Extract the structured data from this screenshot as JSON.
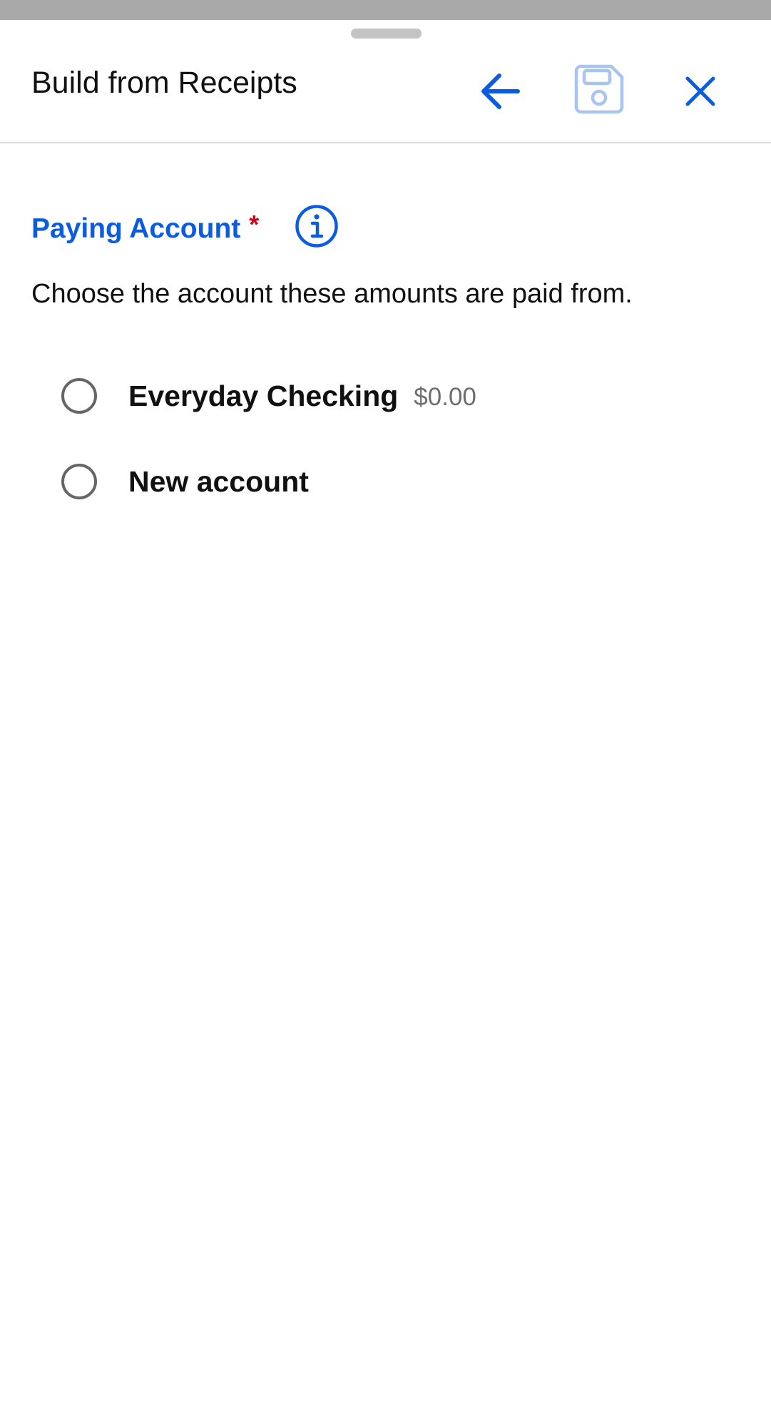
{
  "header": {
    "title": "Build from Receipts",
    "back_icon": "arrow-left-icon",
    "save_icon": "floppy-disk-icon",
    "close_icon": "close-x-icon",
    "accent_color": "#0b5ce0",
    "save_icon_color": "#a8c4f0"
  },
  "field": {
    "label": "Paying Account",
    "required_marker": "*",
    "required_color": "#d0021b",
    "info_icon": "info-icon",
    "helper_text": "Choose the account these amounts are paid from."
  },
  "options": [
    {
      "label": "Everyday Checking",
      "amount": "$0.00",
      "selected": false
    },
    {
      "label": "New account",
      "amount": "",
      "selected": false
    }
  ]
}
